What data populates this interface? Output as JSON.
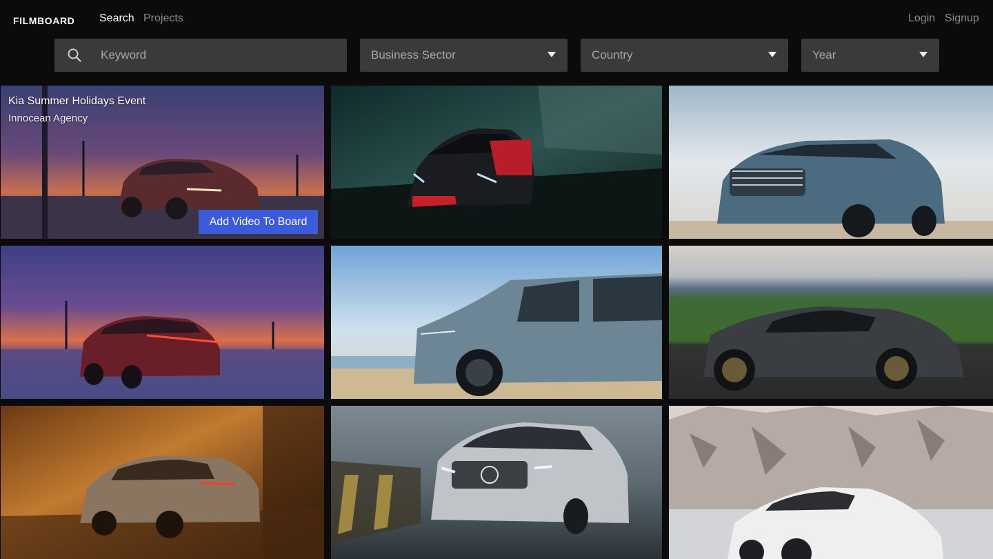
{
  "nav": {
    "logo": "FILMBOARD",
    "links": {
      "search": "Search",
      "projects": "Projects"
    },
    "auth": {
      "login": "Login",
      "signup": "Signup"
    }
  },
  "filters": {
    "keyword_placeholder": "Keyword",
    "business_sector": "Business Sector",
    "country": "Country",
    "year": "Year"
  },
  "colors": {
    "background": "#0b0b0b",
    "field": "#3a3a3a",
    "accent_button": "#3b5bdb"
  },
  "videos": [
    {
      "title": "Kia Summer Holidays Event",
      "agency": "Innocean Agency",
      "action": "Add Video To Board"
    }
  ]
}
